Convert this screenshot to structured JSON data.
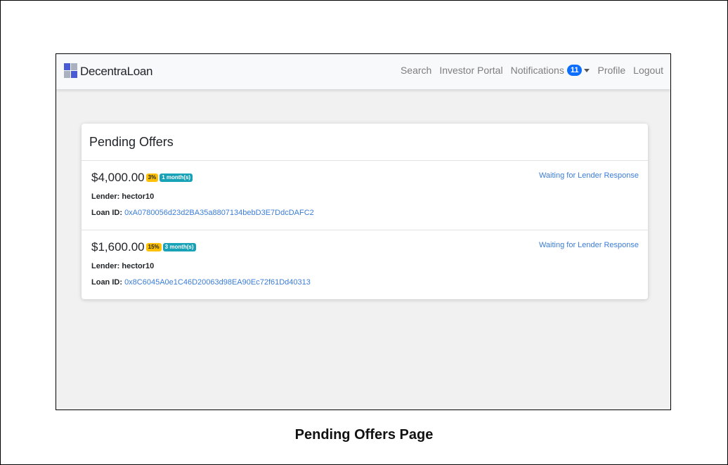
{
  "navbar": {
    "brand": "DecentraLoan",
    "links": {
      "search": "Search",
      "investor_portal": "Investor Portal",
      "notifications": "Notifications",
      "notifications_count": "11",
      "profile": "Profile",
      "logout": "Logout"
    }
  },
  "card": {
    "title": "Pending Offers",
    "offers": [
      {
        "amount": "$4,000.00",
        "rate": "3%",
        "term": "1 month(s)",
        "lender_label": "Lender:",
        "lender": "hector10",
        "loan_id_label": "Loan ID:",
        "loan_id": "0xA0780056d23d2BA35a8807134bebD3E7DdcDAFC2",
        "status": "Waiting for Lender Response"
      },
      {
        "amount": "$1,600.00",
        "rate": "15%",
        "term": "3 month(s)",
        "lender_label": "Lender:",
        "lender": "hector10",
        "loan_id_label": "Loan ID:",
        "loan_id": "0x8C6045A0e1C46D20063d98EA90Ec72f61Dd40313",
        "status": "Waiting for Lender Response"
      }
    ]
  },
  "caption": "Pending Offers Page",
  "colors": {
    "accent": "#0d6efd",
    "link": "#3b7dd8",
    "rate_badge": "#ffc107",
    "term_badge": "#17a2b8"
  }
}
